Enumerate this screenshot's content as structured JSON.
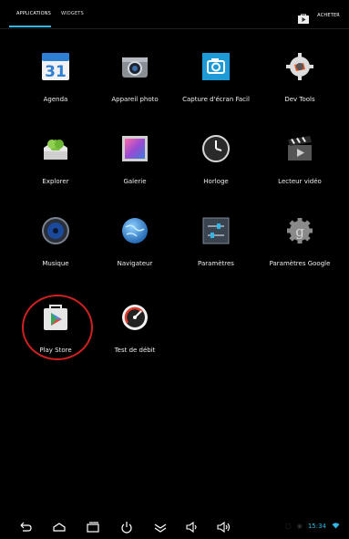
{
  "tabs": [
    {
      "label": "APPLICATIONS",
      "active": true
    },
    {
      "label": "WIDGETS",
      "active": false
    }
  ],
  "buy": {
    "label": "ACHETER",
    "icon": "shopping-bag-icon"
  },
  "apps": [
    {
      "label": "Agenda",
      "icon": "calendar-icon"
    },
    {
      "label": "Appareil photo",
      "icon": "camera-icon"
    },
    {
      "label": "Capture d'écran Facil",
      "icon": "screenshot-icon"
    },
    {
      "label": "Dev Tools",
      "icon": "dev-tools-icon"
    },
    {
      "label": "Explorer",
      "icon": "explorer-icon"
    },
    {
      "label": "Galerie",
      "icon": "gallery-icon"
    },
    {
      "label": "Horloge",
      "icon": "clock-icon"
    },
    {
      "label": "Lecteur vidéo",
      "icon": "video-player-icon"
    },
    {
      "label": "Musique",
      "icon": "music-icon"
    },
    {
      "label": "Navigateur",
      "icon": "browser-icon"
    },
    {
      "label": "Paramètres",
      "icon": "settings-icon"
    },
    {
      "label": "Paramètres Google",
      "icon": "google-settings-icon"
    },
    {
      "label": "Play Store",
      "icon": "play-store-icon"
    },
    {
      "label": "Test de débit",
      "icon": "speedtest-icon"
    }
  ],
  "calendar_day": "31",
  "status": {
    "time": "15:34"
  },
  "colors": {
    "accent": "#33b5e5",
    "highlight_circle": "#d02020"
  }
}
